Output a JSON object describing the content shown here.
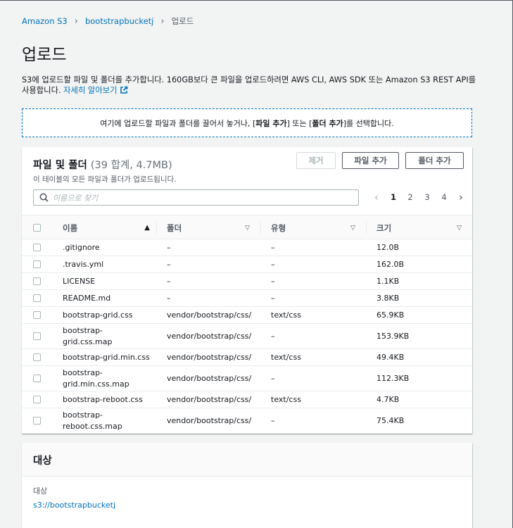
{
  "breadcrumb": [
    "Amazon S3",
    "bootstrapbucketj",
    "업로드"
  ],
  "page_title": "업로드",
  "description": {
    "text": "S3에 업로드할 파일 및 폴더를 추가합니다. 160GB보다 큰 파일을 업로드하려면 AWS CLI, AWS SDK 또는 Amazon S3 REST API를 사용합니다.",
    "link": "자세히 알아보기"
  },
  "dropzone": {
    "prefix": "여기에 업로드할 파일과 폴더를 끌어서 놓거나, [",
    "add_files": "파일 추가",
    "middle": "] 또는 [",
    "add_folder": "폴더 추가",
    "suffix": "]를 선택합니다."
  },
  "files_panel": {
    "title": "파일 및 폴더",
    "count": "(39 합계, 4.7MB)",
    "subtitle": "이 테이블의 모든 파일과 폴더가 업로드됩니다.",
    "remove_button": "제거",
    "add_files_button": "파일 추가",
    "add_folder_button": "폴더 추가",
    "search_placeholder": "이름으로 찾기",
    "pages": [
      "1",
      "2",
      "3",
      "4"
    ],
    "current_page": "1",
    "columns": [
      "이름",
      "폴더",
      "유형",
      "크기"
    ],
    "rows": [
      {
        "name": ".gitignore",
        "folder": "–",
        "type": "–",
        "size": "12.0B"
      },
      {
        "name": ".travis.yml",
        "folder": "–",
        "type": "–",
        "size": "162.0B"
      },
      {
        "name": "LICENSE",
        "folder": "–",
        "type": "–",
        "size": "1.1KB"
      },
      {
        "name": "README.md",
        "folder": "–",
        "type": "–",
        "size": "3.8KB"
      },
      {
        "name": "bootstrap-grid.css",
        "folder": "vendor/bootstrap/css/",
        "type": "text/css",
        "size": "65.9KB"
      },
      {
        "name": "bootstrap-grid.css.map",
        "folder": "vendor/bootstrap/css/",
        "type": "–",
        "size": "153.9KB"
      },
      {
        "name": "bootstrap-grid.min.css",
        "folder": "vendor/bootstrap/css/",
        "type": "text/css",
        "size": "49.4KB"
      },
      {
        "name": "bootstrap-grid.min.css.map",
        "folder": "vendor/bootstrap/css/",
        "type": "–",
        "size": "112.3KB"
      },
      {
        "name": "bootstrap-reboot.css",
        "folder": "vendor/bootstrap/css/",
        "type": "text/css",
        "size": "4.7KB"
      },
      {
        "name": "bootstrap-reboot.css.map",
        "folder": "vendor/bootstrap/css/",
        "type": "–",
        "size": "75.4KB"
      }
    ]
  },
  "destination": {
    "title": "대상",
    "label": "대상",
    "value": "s3://bootstrapbucketj"
  },
  "colors": {
    "link": "#0073bb",
    "background": "#f2f3f3",
    "border": "#eaeded"
  }
}
